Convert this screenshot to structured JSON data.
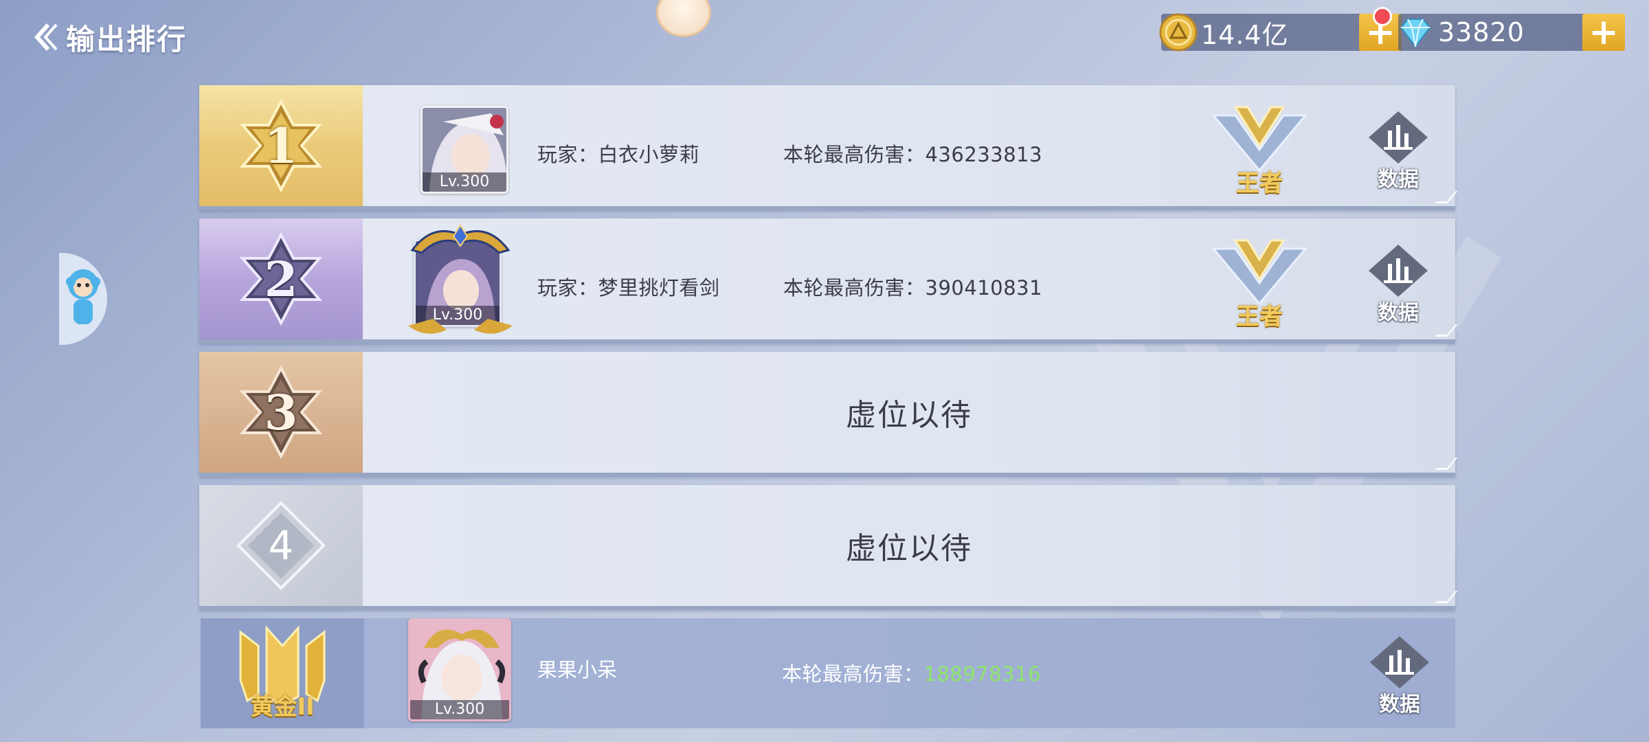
{
  "header": {
    "back_label": "输出排行"
  },
  "currencies": {
    "gold": "14.4亿",
    "gems": "33820",
    "plus_symbol": "+"
  },
  "colors": {
    "highlight_green": "#8ee46b",
    "tier_gold": "#f2cb5e"
  },
  "rows": [
    {
      "rank": "1",
      "avatar_level": "Lv.300",
      "player": "玩家：白衣小萝莉",
      "damage_label": "本轮最高伤害：",
      "damage_value": "436233813",
      "tier": "王者",
      "data_label": "数据"
    },
    {
      "rank": "2",
      "avatar_level": "Lv.300",
      "player": "玩家：梦里挑灯看剑",
      "damage_label": "本轮最高伤害：",
      "damage_value": "390410831",
      "tier": "王者",
      "data_label": "数据"
    },
    {
      "rank": "3",
      "placeholder": "虚位以待"
    },
    {
      "rank": "4",
      "placeholder": "虚位以待"
    }
  ],
  "self": {
    "tier": "黄金II",
    "avatar_level": "Lv.300",
    "name": "果果小呆",
    "damage_label": "本轮最高伤害：",
    "damage_value": "188978316",
    "data_label": "数据"
  }
}
